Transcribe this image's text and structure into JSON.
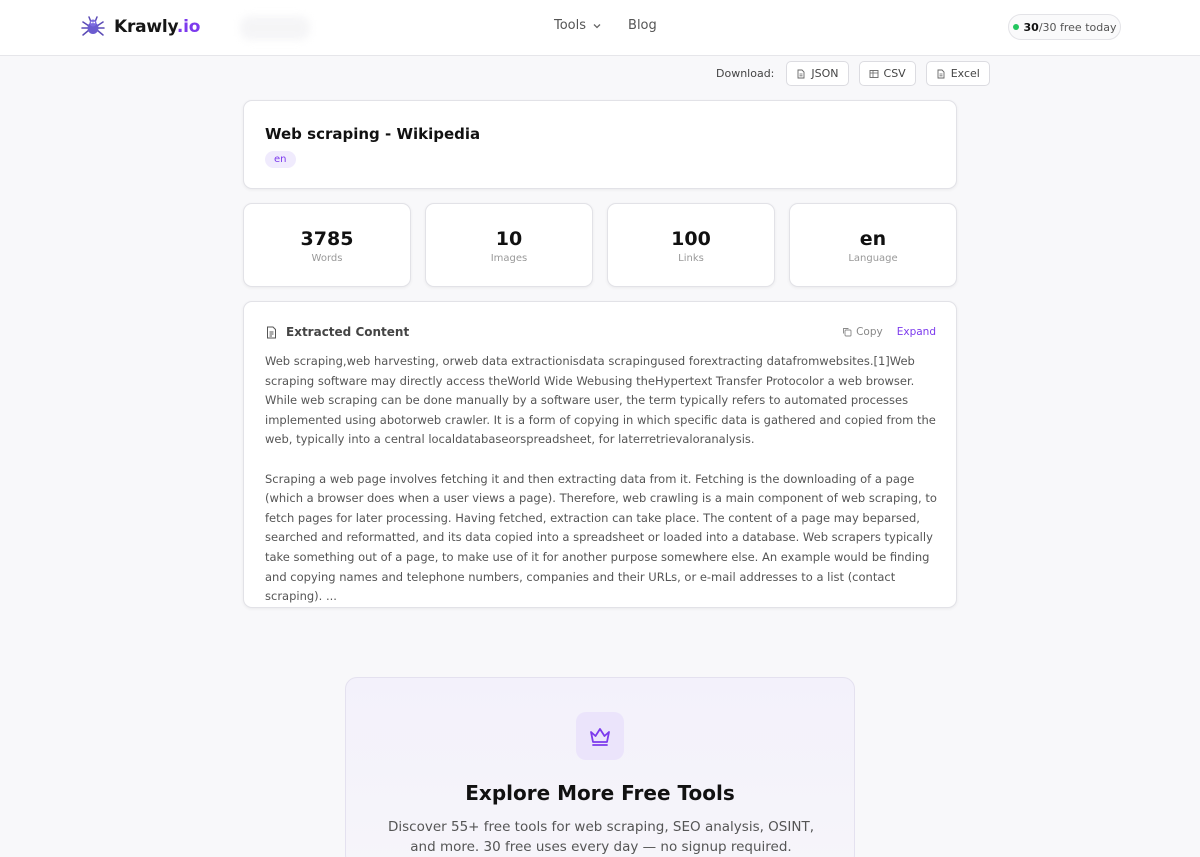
{
  "header": {
    "logo_name": "Krawly",
    "logo_tld": ".io",
    "nav": [
      {
        "label": "Tools"
      },
      {
        "label": "Blog"
      }
    ],
    "quota_used": "30",
    "quota_rest": "/30 free today"
  },
  "download": {
    "label": "Download:",
    "buttons": [
      {
        "label": "JSON"
      },
      {
        "label": "CSV"
      },
      {
        "label": "Excel"
      }
    ]
  },
  "page": {
    "title": "Web scraping - Wikipedia",
    "language_badge": "en"
  },
  "stats": [
    {
      "value": "3785",
      "label": "Words"
    },
    {
      "value": "10",
      "label": "Images"
    },
    {
      "value": "100",
      "label": "Links"
    },
    {
      "value": "en",
      "label": "Language"
    }
  ],
  "content": {
    "heading": "Extracted Content",
    "copy_label": "Copy",
    "expand_label": "Expand",
    "paragraphs": [
      "Web scraping,web harvesting, orweb data extractionisdata scrapingused forextracting datafromwebsites.[1]Web scraping software may directly access theWorld Wide Webusing theHypertext Transfer Protocolor a web browser. While web scraping can be done manually by a software user, the term typically refers to automated processes implemented using abotorweb crawler. It is a form of copying in which specific data is gathered and copied from the web, typically into a central localdatabaseorspreadsheet, for laterretrievaloranalysis.",
      "Scraping a web page involves fetching it and then extracting data from it. Fetching is the downloading of a page (which a browser does when a user views a page). Therefore, web crawling is a main component of web scraping, to fetch pages for later processing. Having fetched, extraction can take place. The content of a page may beparsed, searched and reformatted, and its data copied into a spreadsheet or loaded into a database. Web scrapers typically take something out of a page, to make use of it for another purpose somewhere else. An example would be finding and copying names and telephone numbers, companies and their URLs, or e-mail addresses to a list (contact scraping). ..."
    ]
  },
  "promo": {
    "title": "Explore More Free Tools",
    "text": "Discover 55+ free tools for web scraping, SEO analysis, OSINT, and more. 30 free uses every day — no signup required."
  },
  "colors": {
    "accent": "#7c3aed",
    "status": "#22c55e"
  },
  "icons": [
    "spider-logo-icon",
    "chevron-down-icon",
    "file-icon",
    "table-icon",
    "document-icon",
    "copy-icon",
    "crown-icon"
  ]
}
